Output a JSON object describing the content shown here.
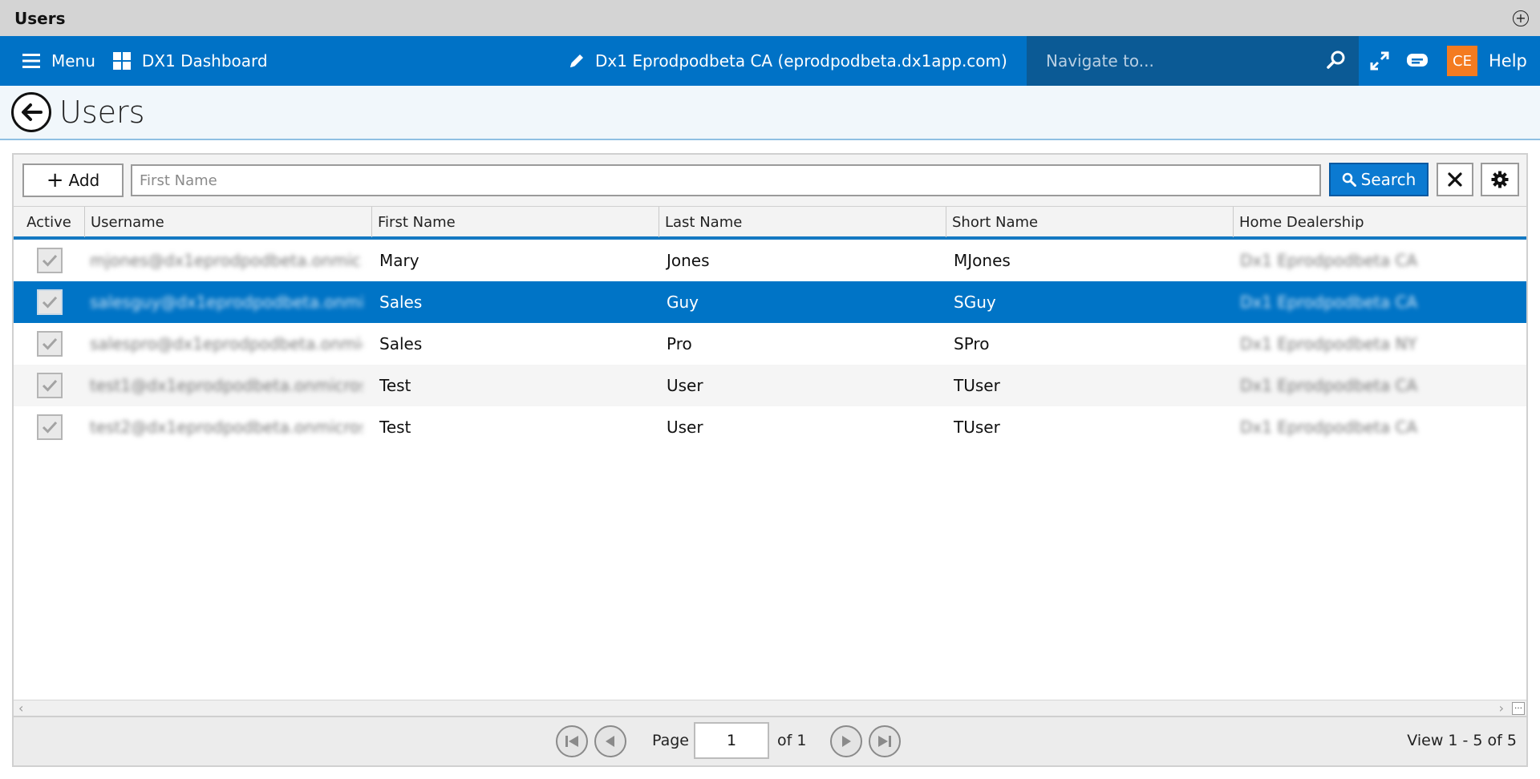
{
  "window": {
    "title": "Users"
  },
  "appbar": {
    "menu_label": "Menu",
    "dashboard_label": "DX1 Dashboard",
    "tenant_label": "Dx1 Eprodpodbeta CA (eprodpodbeta.dx1app.com)",
    "navigate_placeholder": "Navigate to...",
    "user_initials": "CE",
    "help_label": "Help"
  },
  "page": {
    "title": "Users"
  },
  "toolbar": {
    "add_label": "Add",
    "first_name_placeholder": "First Name",
    "search_label": "Search"
  },
  "grid": {
    "columns": [
      "Active",
      "Username",
      "First Name",
      "Last Name",
      "Short Name",
      "Home Dealership"
    ],
    "rows": [
      {
        "active": true,
        "username": "mjones@dx1eprodpodbeta.onmic...",
        "first_name": "Mary",
        "last_name": "Jones",
        "short_name": "MJones",
        "home_dealership": "Dx1 Eprodpodbeta CA"
      },
      {
        "active": true,
        "username": "salesguy@dx1eprodpodbeta.onmi...",
        "first_name": "Sales",
        "last_name": "Guy",
        "short_name": "SGuy",
        "home_dealership": "Dx1 Eprodpodbeta CA"
      },
      {
        "active": true,
        "username": "salespro@dx1eprodpodbeta.onmic...",
        "first_name": "Sales",
        "last_name": "Pro",
        "short_name": "SPro",
        "home_dealership": "Dx1 Eprodpodbeta NY"
      },
      {
        "active": true,
        "username": "test1@dx1eprodpodbeta.onmicros...",
        "first_name": "Test",
        "last_name": "User",
        "short_name": "TUser",
        "home_dealership": "Dx1 Eprodpodbeta CA"
      },
      {
        "active": true,
        "username": "test2@dx1eprodpodbeta.onmicros...",
        "first_name": "Test",
        "last_name": "User",
        "short_name": "TUser",
        "home_dealership": "Dx1 Eprodpodbeta CA"
      }
    ],
    "selected_row": 1
  },
  "pager": {
    "page_label": "Page",
    "current_page": "1",
    "of_label": "of 1",
    "summary": "View 1 - 5 of 5"
  },
  "colors": {
    "brand_blue": "#0072c6",
    "nav_dark": "#0b5a95",
    "accent_orange": "#f47b20",
    "selected_row": "#0074c6"
  },
  "icons": [
    "hamburger-icon",
    "grid-icon",
    "pencil-icon",
    "search-icon",
    "expand-icon",
    "chat-icon",
    "back-arrow-icon",
    "plus-icon",
    "close-icon",
    "gear-icon",
    "check-icon",
    "first-page-icon",
    "prev-page-icon",
    "next-page-icon",
    "last-page-icon"
  ]
}
